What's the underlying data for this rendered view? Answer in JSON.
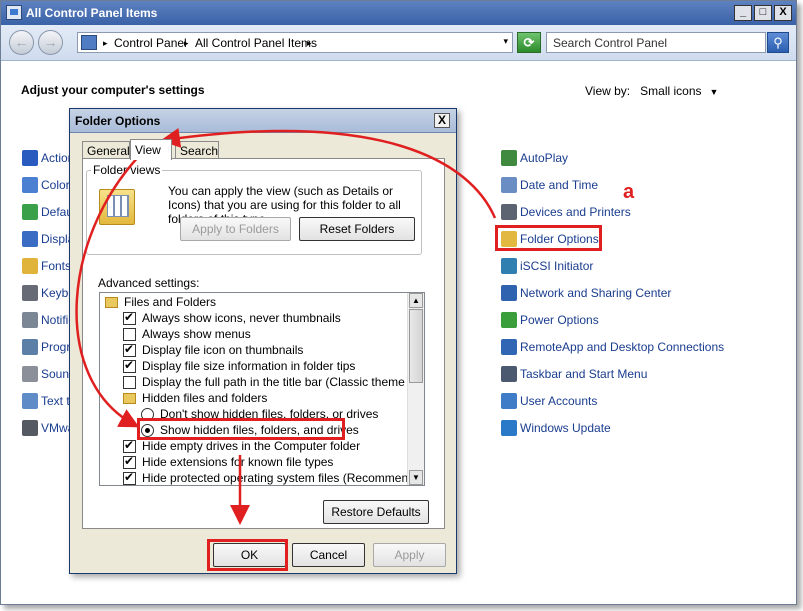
{
  "window": {
    "title": "All Control Panel Items",
    "controls": {
      "minimize": "_",
      "maximize": "□",
      "close": "X"
    }
  },
  "navbar": {
    "back": "←",
    "forward": "→",
    "breadcrumb_sep": "▸",
    "breadcrumb": [
      "Control Panel",
      "All Control Panel Items"
    ],
    "address_dropdown": "▾",
    "refresh": "⟳",
    "search_placeholder": "Search Control Panel",
    "search_icon": "⚲"
  },
  "main": {
    "heading": "Adjust your computer's settings",
    "view_by_label": "View by:",
    "view_by_value": "Small icons",
    "view_by_arrow": "▼",
    "marker": "a",
    "left_items": [
      {
        "label": "Action",
        "icon": "flag-icon",
        "color": "#2a5bbf"
      },
      {
        "label": "Color M",
        "icon": "monitor-icon",
        "color": "#4a7fd1"
      },
      {
        "label": "Defaul",
        "icon": "default-programs-icon",
        "color": "#3aa04a"
      },
      {
        "label": "Displa",
        "icon": "display-icon",
        "color": "#3a6cc4"
      },
      {
        "label": "Fonts",
        "icon": "fonts-folder-icon",
        "color": "#e0b33a"
      },
      {
        "label": "Keybo",
        "icon": "keyboard-icon",
        "color": "#666b75"
      },
      {
        "label": "Notific",
        "icon": "notification-icon",
        "color": "#7c8796"
      },
      {
        "label": "Progra",
        "icon": "programs-icon",
        "color": "#5c7fa8"
      },
      {
        "label": "Sound",
        "icon": "speaker-icon",
        "color": "#8a8f99"
      },
      {
        "label": "Text t",
        "icon": "text-to-speech-icon",
        "color": "#5f8cc6"
      },
      {
        "label": "VMwar",
        "icon": "vmware-icon",
        "color": "#555a62"
      }
    ],
    "right_items": [
      {
        "label": "AutoPlay",
        "icon": "autoplay-icon",
        "color": "#3f8a3f"
      },
      {
        "label": "Date and Time",
        "icon": "clock-icon",
        "color": "#6a8ec4"
      },
      {
        "label": "Devices and Printers",
        "icon": "printer-icon",
        "color": "#5b6470"
      },
      {
        "label": "Folder Options",
        "icon": "folder-options-icon",
        "color": "#e2b840"
      },
      {
        "label": "iSCSI Initiator",
        "icon": "iscsi-icon",
        "color": "#2f7fb0"
      },
      {
        "label": "Network and Sharing Center",
        "icon": "network-icon",
        "color": "#2f63b0"
      },
      {
        "label": "Power Options",
        "icon": "power-icon",
        "color": "#3a9e3a"
      },
      {
        "label": "RemoteApp and Desktop Connections",
        "icon": "remoteapp-icon",
        "color": "#3166b5"
      },
      {
        "label": "Taskbar and Start Menu",
        "icon": "taskbar-icon",
        "color": "#4c5a6f"
      },
      {
        "label": "User Accounts",
        "icon": "user-accounts-icon",
        "color": "#3e7cc8"
      },
      {
        "label": "Windows Update",
        "icon": "windows-update-icon",
        "color": "#2a79c9"
      }
    ]
  },
  "dialog": {
    "title": "Folder Options",
    "close": "X",
    "tabs": [
      "General",
      "View",
      "Search"
    ],
    "group_title": "Folder views",
    "group_desc": "You can apply the view (such as Details or Icons) that you are using for this folder to all folders of this type.",
    "apply_to_folders": "Apply to Folders",
    "reset_folders": "Reset Folders",
    "advanced_label": "Advanced settings:",
    "scroll_up": "▲",
    "scroll_down": "▼",
    "tree": [
      {
        "type": "folder",
        "label": "Files and Folders",
        "indent": 0
      },
      {
        "type": "check",
        "checked": true,
        "label": "Always show icons, never thumbnails",
        "indent": 1
      },
      {
        "type": "check",
        "checked": false,
        "label": "Always show menus",
        "indent": 1
      },
      {
        "type": "check",
        "checked": true,
        "label": "Display file icon on thumbnails",
        "indent": 1
      },
      {
        "type": "check",
        "checked": true,
        "label": "Display file size information in folder tips",
        "indent": 1
      },
      {
        "type": "check",
        "checked": false,
        "label": "Display the full path in the title bar (Classic theme only)",
        "indent": 1
      },
      {
        "type": "folder",
        "label": "Hidden files and folders",
        "indent": 1
      },
      {
        "type": "radio",
        "checked": false,
        "label": "Don't show hidden files, folders, or drives",
        "indent": 2
      },
      {
        "type": "radio",
        "checked": true,
        "label": "Show hidden files, folders, and drives",
        "indent": 2
      },
      {
        "type": "check",
        "checked": true,
        "label": "Hide empty drives in the Computer folder",
        "indent": 1
      },
      {
        "type": "check",
        "checked": true,
        "label": "Hide extensions for known file types",
        "indent": 1
      },
      {
        "type": "check",
        "checked": true,
        "label": "Hide protected operating system files (Recommended)",
        "indent": 1
      }
    ],
    "restore_defaults": "Restore Defaults",
    "ok": "OK",
    "cancel": "Cancel",
    "apply": "Apply"
  },
  "annotation_color": "#e02020"
}
